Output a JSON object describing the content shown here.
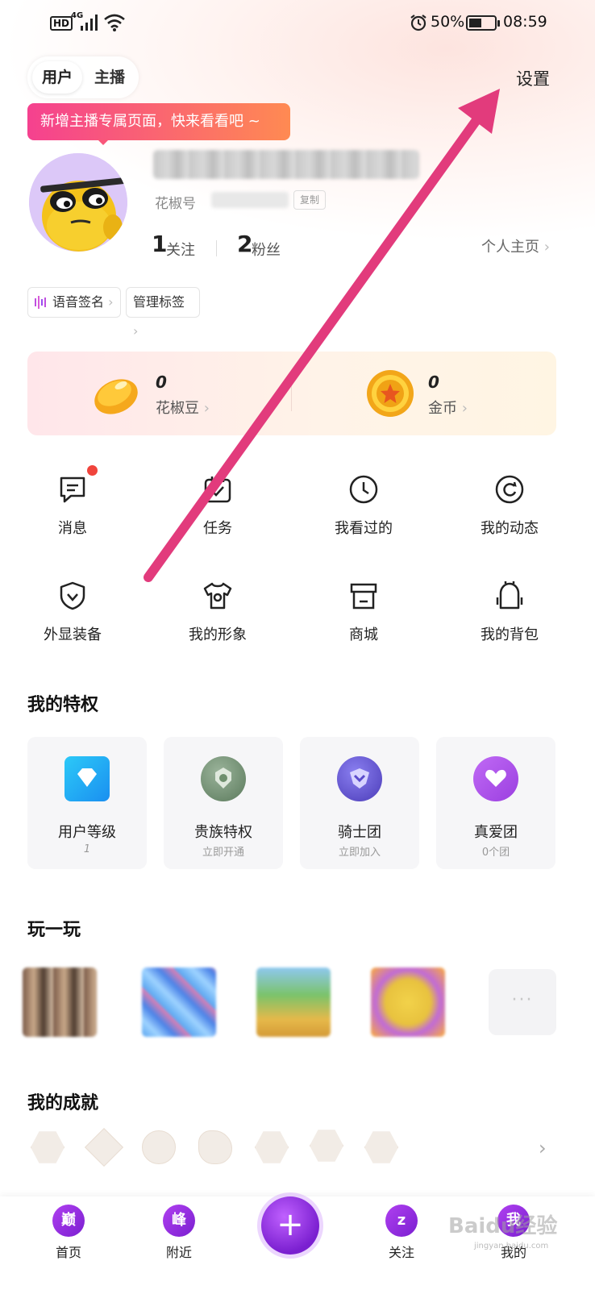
{
  "status_bar": {
    "hd": "HD",
    "network": "4G",
    "battery_percent": "50%",
    "time": "08:59"
  },
  "header": {
    "role_user": "用户",
    "role_anchor": "主播",
    "settings": "设置",
    "promo": "新增主播专属页面，快来看看吧 ~"
  },
  "profile": {
    "id_label": "花椒号",
    "following_count": "1",
    "following_label": "关注",
    "fans_count": "2",
    "fans_label": "粉丝",
    "homepage_link": "个人主页",
    "tags": [
      "语音签名",
      "管理标签"
    ]
  },
  "wallet": {
    "beans_value": "0",
    "beans_label": "花椒豆",
    "coins_value": "0",
    "coins_label": "金币"
  },
  "menu": [
    {
      "label": "消息",
      "icon": "message-icon"
    },
    {
      "label": "任务",
      "icon": "task-icon"
    },
    {
      "label": "我看过的",
      "icon": "clock-icon"
    },
    {
      "label": "我的动态",
      "icon": "refresh-icon"
    },
    {
      "label": "外显装备",
      "icon": "shield-icon"
    },
    {
      "label": "我的形象",
      "icon": "tshirt-icon"
    },
    {
      "label": "商城",
      "icon": "shop-icon"
    },
    {
      "label": "我的背包",
      "icon": "backpack-icon"
    }
  ],
  "privileges": {
    "title": "我的特权",
    "items": [
      {
        "label": "用户等级",
        "sub": "1",
        "color": "#2ab7f5"
      },
      {
        "label": "贵族特权",
        "sub": "立即开通",
        "color": "#6e8f6d"
      },
      {
        "label": "骑士团",
        "sub": "立即加入",
        "color": "#6a5bd6"
      },
      {
        "label": "真爱团",
        "sub": "0个团",
        "color": "#b554e8"
      }
    ]
  },
  "games": {
    "title": "玩一玩",
    "more": "···"
  },
  "achievements": {
    "title": "我的成就"
  },
  "bottom_nav": {
    "home": "首页",
    "home_icon_text": "巅",
    "nearby": "附近",
    "nearby_icon_text": "峰",
    "plus": "+",
    "follow": "关注",
    "follow_icon_text": "z",
    "mine": "我的",
    "mine_icon_text": "我"
  },
  "watermark": {
    "text": "Baidu经验",
    "sub": "jingyan.baidu.com"
  },
  "colors": {
    "accent": "#e83a7e",
    "brand_purple": "#8e2de2"
  }
}
